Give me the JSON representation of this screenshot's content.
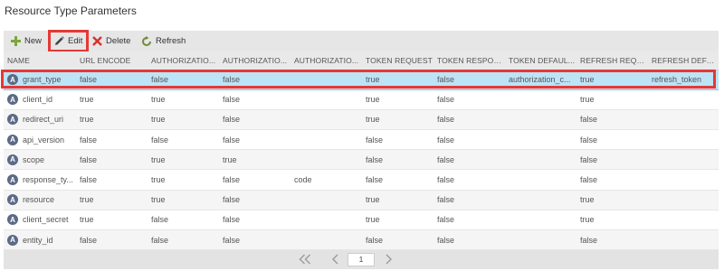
{
  "page": {
    "title": "Resource Type Parameters"
  },
  "toolbar": {
    "new_label": "New",
    "edit_label": "Edit",
    "delete_label": "Delete",
    "refresh_label": "Refresh"
  },
  "grid": {
    "columns": [
      "NAME",
      "URL ENCODE",
      "AUTHORIZATIO...",
      "AUTHORIZATIO...",
      "AUTHORIZATIO...",
      "TOKEN REQUEST",
      "TOKEN RESPON...",
      "TOKEN DEFAUL...",
      "REFRESH REQU...",
      "REFRESH DEFAU..."
    ],
    "rows": [
      {
        "name": "grant_type",
        "c1": "false",
        "c2": "false",
        "c3": "false",
        "c4": "",
        "c5": "true",
        "c6": "false",
        "c7": "authorization_c...",
        "c8": "true",
        "c9": "refresh_token"
      },
      {
        "name": "client_id",
        "c1": "true",
        "c2": "true",
        "c3": "false",
        "c4": "",
        "c5": "true",
        "c6": "false",
        "c7": "",
        "c8": "true",
        "c9": ""
      },
      {
        "name": "redirect_uri",
        "c1": "true",
        "c2": "true",
        "c3": "false",
        "c4": "",
        "c5": "true",
        "c6": "false",
        "c7": "",
        "c8": "false",
        "c9": ""
      },
      {
        "name": "api_version",
        "c1": "false",
        "c2": "false",
        "c3": "false",
        "c4": "",
        "c5": "false",
        "c6": "false",
        "c7": "",
        "c8": "false",
        "c9": ""
      },
      {
        "name": "scope",
        "c1": "false",
        "c2": "true",
        "c3": "true",
        "c4": "",
        "c5": "false",
        "c6": "false",
        "c7": "",
        "c8": "false",
        "c9": ""
      },
      {
        "name": "response_ty...",
        "c1": "false",
        "c2": "true",
        "c3": "false",
        "c4": "code",
        "c5": "false",
        "c6": "false",
        "c7": "",
        "c8": "false",
        "c9": ""
      },
      {
        "name": "resource",
        "c1": "true",
        "c2": "true",
        "c3": "false",
        "c4": "",
        "c5": "true",
        "c6": "false",
        "c7": "",
        "c8": "true",
        "c9": ""
      },
      {
        "name": "client_secret",
        "c1": "true",
        "c2": "false",
        "c3": "false",
        "c4": "",
        "c5": "true",
        "c6": "false",
        "c7": "",
        "c8": "true",
        "c9": ""
      },
      {
        "name": "entity_id",
        "c1": "false",
        "c2": "false",
        "c3": "false",
        "c4": "",
        "c5": "false",
        "c6": "false",
        "c7": "",
        "c8": "false",
        "c9": ""
      }
    ],
    "selected_row": 0
  },
  "pager": {
    "current_page": "1"
  },
  "icons": {
    "new": "plus-icon",
    "edit": "pencil-icon",
    "delete": "x-icon",
    "refresh": "refresh-icon",
    "row": "letter-a-icon",
    "first": "double-chevron-left-icon",
    "prev": "chevron-left-icon",
    "next": "chevron-right-icon"
  },
  "colors": {
    "selected_row": "#bde3f6",
    "highlight": "#e53935",
    "new_icon": "#7aa83a",
    "delete_icon": "#d9302c",
    "refresh_icon": "#6d8b3a",
    "row_icon": "#5b6a86"
  }
}
